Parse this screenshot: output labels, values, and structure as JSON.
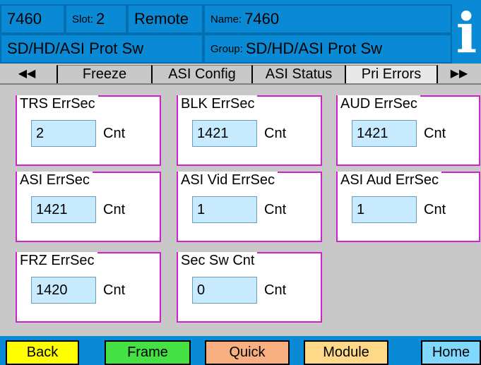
{
  "header": {
    "model": "7460",
    "slot_label": "Slot:",
    "slot_value": "2",
    "mode": "Remote",
    "name_label": "Name:",
    "name_value": "7460",
    "card_type": "SD/HD/ASI Prot Sw",
    "group_label": "Group:",
    "group_value": "SD/HD/ASI Prot Sw",
    "info_icon": "i"
  },
  "tabs": {
    "prev_arrow": "◀◀",
    "next_arrow": "▶▶",
    "items": [
      {
        "label": "Freeze"
      },
      {
        "label": "ASI Config"
      },
      {
        "label": "ASI Status"
      },
      {
        "label": "Pri Errors"
      }
    ],
    "active": "Pri Errors"
  },
  "panels": [
    {
      "title": "TRS ErrSec",
      "value": "2",
      "unit": "Cnt"
    },
    {
      "title": "BLK ErrSec",
      "value": "1421",
      "unit": "Cnt"
    },
    {
      "title": "AUD ErrSec",
      "value": "1421",
      "unit": "Cnt"
    },
    {
      "title": "ASI ErrSec",
      "value": "1421",
      "unit": "Cnt"
    },
    {
      "title": "ASI Vid ErrSec",
      "value": "1",
      "unit": "Cnt"
    },
    {
      "title": "ASI Aud ErrSec",
      "value": "1",
      "unit": "Cnt"
    },
    {
      "title": "FRZ ErrSec",
      "value": "1420",
      "unit": "Cnt"
    },
    {
      "title": "Sec Sw Cnt",
      "value": "0",
      "unit": "Cnt"
    }
  ],
  "nav": {
    "back": {
      "label": "Back",
      "color": "#ffff00"
    },
    "frame": {
      "label": "Frame",
      "color": "#44e044"
    },
    "quick": {
      "label": "Quick",
      "color": "#f8b080"
    },
    "module": {
      "label": "Module",
      "color": "#ffd888"
    },
    "home": {
      "label": "Home",
      "color": "#80d8ff"
    }
  },
  "colors": {
    "header_bg": "#0a8ad4",
    "panel_border": "#d020d0",
    "value_bg": "#c8eaff",
    "screen_bg": "#c8c8c8"
  }
}
